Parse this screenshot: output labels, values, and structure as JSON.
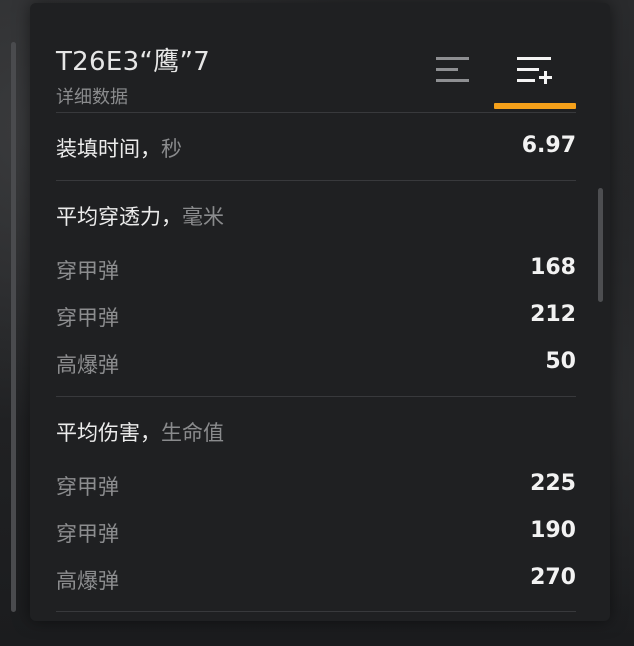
{
  "header": {
    "title": "T26E3“鹰”7",
    "subtitle": "详细数据"
  },
  "tabs": [
    {
      "name": "basic",
      "icon": "lines-icon",
      "active": false
    },
    {
      "name": "detailed",
      "icon": "lines-plus-icon",
      "active": true
    }
  ],
  "accent_color": "#f5a01a",
  "reload": {
    "label": "装填时间，",
    "unit": "秒",
    "value": "6.97"
  },
  "penetration": {
    "label": "平均穿透力，",
    "unit": "毫米",
    "rows": [
      {
        "label": "穿甲弹",
        "value": "168"
      },
      {
        "label": "穿甲弹",
        "value": "212"
      },
      {
        "label": "高爆弹",
        "value": "50"
      }
    ]
  },
  "damage": {
    "label": "平均伤害，",
    "unit": "生命值",
    "rows": [
      {
        "label": "穿甲弹",
        "value": "225"
      },
      {
        "label": "穿甲弹",
        "value": "190"
      },
      {
        "label": "高爆弹",
        "value": "270"
      }
    ]
  }
}
